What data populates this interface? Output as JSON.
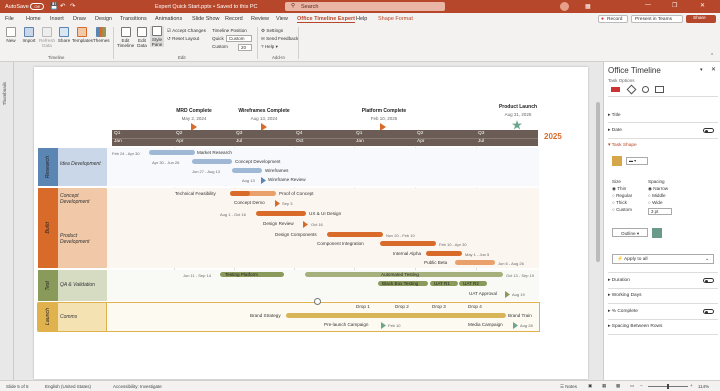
{
  "titlebar": {
    "autosave": "AutoSave",
    "autosave_state": "Off",
    "doc_title": "Expert Quick Start.pptx • Saved to this PC",
    "search_placeholder": "Search",
    "window_controls": [
      "—",
      "❐",
      "✕"
    ]
  },
  "tabs": [
    "File",
    "Home",
    "Insert",
    "Draw",
    "Design",
    "Transitions",
    "Animations",
    "Slide Show",
    "Record",
    "Review",
    "View",
    "Office Timeline Expert",
    "Help",
    "Shape Format"
  ],
  "active_tab": "Office Timeline Expert",
  "tab_actions": {
    "record": "Record",
    "present": "Present in Teams",
    "share": "Share"
  },
  "ribbon": {
    "groups": [
      {
        "name": "Timeline",
        "buttons": [
          "New",
          "Import",
          "Refresh Data",
          "Share",
          "Templates",
          "Themes"
        ]
      },
      {
        "name": "Edit",
        "buttons": [
          "Edit Timeline",
          "Edit Data",
          "Style Pane"
        ]
      },
      {
        "name": "Add-In",
        "buttons": []
      }
    ],
    "edit_options": {
      "accept_changes": "Accept Changes",
      "reset_layout": "Reset Layout"
    },
    "timeline_position": {
      "label": "Timeline Position",
      "mode": "Quick",
      "value": "Custom",
      "custom_label": "Custom",
      "custom_value": "20"
    },
    "addin": {
      "settings": "Settings",
      "feedback": "Send Feedback",
      "help": "Help"
    }
  },
  "thumbnails_label": "Thumbnails",
  "timeline": {
    "year_label": "2025",
    "quarters": [
      "Q1",
      "Q2",
      "Q3",
      "Q4",
      "Q1",
      "Q2",
      "Q3"
    ],
    "months": [
      "Jan",
      "Apr",
      "Jul",
      "Oct",
      "Jan",
      "Apr",
      "Jul"
    ],
    "milestones_top": [
      {
        "title": "MRD Complete",
        "date": "May 2, 2024",
        "color": "#d86b2a"
      },
      {
        "title": "Wireframes Complete",
        "date": "Aug 13, 2024",
        "color": "#d86b2a"
      },
      {
        "title": "Platform Complete",
        "date": "Feb 10, 2025",
        "color": "#d86b2a"
      },
      {
        "title": "Product Launch",
        "date": "Aug 31, 2025",
        "color": "#6aa58c"
      }
    ],
    "swimlanes": [
      {
        "name": "Research",
        "color": "#5b86b3",
        "light": "#c9d7e8",
        "tasks": [
          "Idea Development"
        ]
      },
      {
        "name": "Build",
        "color": "#d86b2a",
        "light": "#f1c9a8",
        "tasks": [
          "Concept Development",
          "Product Development"
        ]
      },
      {
        "name": "Test",
        "color": "#8a9a5b",
        "light": "#d6dcc2",
        "tasks": [
          "QA & Validation"
        ]
      },
      {
        "name": "Launch",
        "color": "#e0b24e",
        "light": "#f4e2b3",
        "tasks": [
          "Comms"
        ]
      }
    ],
    "items": {
      "market_research": {
        "label": "Market Research",
        "date": "Feb 24 - Apr 30"
      },
      "concept_dev": {
        "label": "Concept Development",
        "date": "Apr 30 - Jun 26"
      },
      "wireframes": {
        "label": "Wireframes",
        "date": "Jun 27 - Aug 13"
      },
      "wireframe_review": {
        "label": "Wireframe Review",
        "date": "Aug 13"
      },
      "tech_feasibility": {
        "label": "Technical Feasibility",
        "date": ""
      },
      "proof_of_concept": {
        "label": "Proof of Concept",
        "date": ""
      },
      "concept_demo": {
        "label": "Concept Demo",
        "date": "Sep 3"
      },
      "ux_ui": {
        "label": "UX & UI Design",
        "date": "Aug 1 - Oct 16"
      },
      "design_review": {
        "label": "Design Review",
        "date": "Oct 16"
      },
      "design_components": {
        "label": "Design Components",
        "date": "Nov 20 - Feb 10"
      },
      "component_integration": {
        "label": "Component Integration",
        "date": "Feb 10 - Apr 30"
      },
      "internal_alpha": {
        "label": "Internal Alpha",
        "date": "May 1 - Jun 5"
      },
      "public_beta": {
        "label": "Public Beta",
        "date": "Jun 6 - Aug 26"
      },
      "testing_platform": {
        "label": "Testing Platform",
        "date": "Jun 11 - Sep 14"
      },
      "automated_testing": {
        "label": "Automated Testing",
        "date": "Oct 13 - Sep 19"
      },
      "black_box": {
        "label": "Black Box Testing",
        "date": ""
      },
      "uat_r1": {
        "label": "UAT R1",
        "date": ""
      },
      "uat_r2": {
        "label": "UAT R2",
        "date": ""
      },
      "uat_approval": {
        "label": "UAT Approval",
        "date": "Aug 19"
      },
      "brand_strategy": {
        "label": "Brand Strategy",
        "date": ""
      },
      "brand_train": {
        "label": "Brand Train",
        "date": ""
      },
      "drops": [
        "Drop 1",
        "Drop 2",
        "Drop 3",
        "Drop 4"
      ],
      "prelaunch": {
        "label": "Pre-launch Campaign",
        "date": "Feb 10"
      },
      "media_campaign": {
        "label": "Media Campaign",
        "date": "Aug 28"
      }
    }
  },
  "panel": {
    "title": "Office Timeline",
    "subtitle": "Task Options",
    "sections": [
      "Title",
      "Date",
      "Task Shape"
    ],
    "size_label": "Size",
    "sizes": [
      "Thin",
      "Regular",
      "Thick",
      "Custom"
    ],
    "spacing_label": "Spacing",
    "spacings": [
      "Narrow",
      "Middle",
      "Wide"
    ],
    "spacing_value": "3 pt",
    "outline": "Outline",
    "apply": "Apply to all",
    "lower_sections": [
      "Duration",
      "Working Days",
      "% Complete",
      "Spacing Between Rows"
    ],
    "shape_color": "#d6a64a",
    "outline_color": "#6a9a8a"
  },
  "status": {
    "slide": "Slide 5 of 5",
    "language": "English (United States)",
    "accessibility": "Accessibility: Investigate",
    "notes": "Notes",
    "zoom": "114%"
  }
}
